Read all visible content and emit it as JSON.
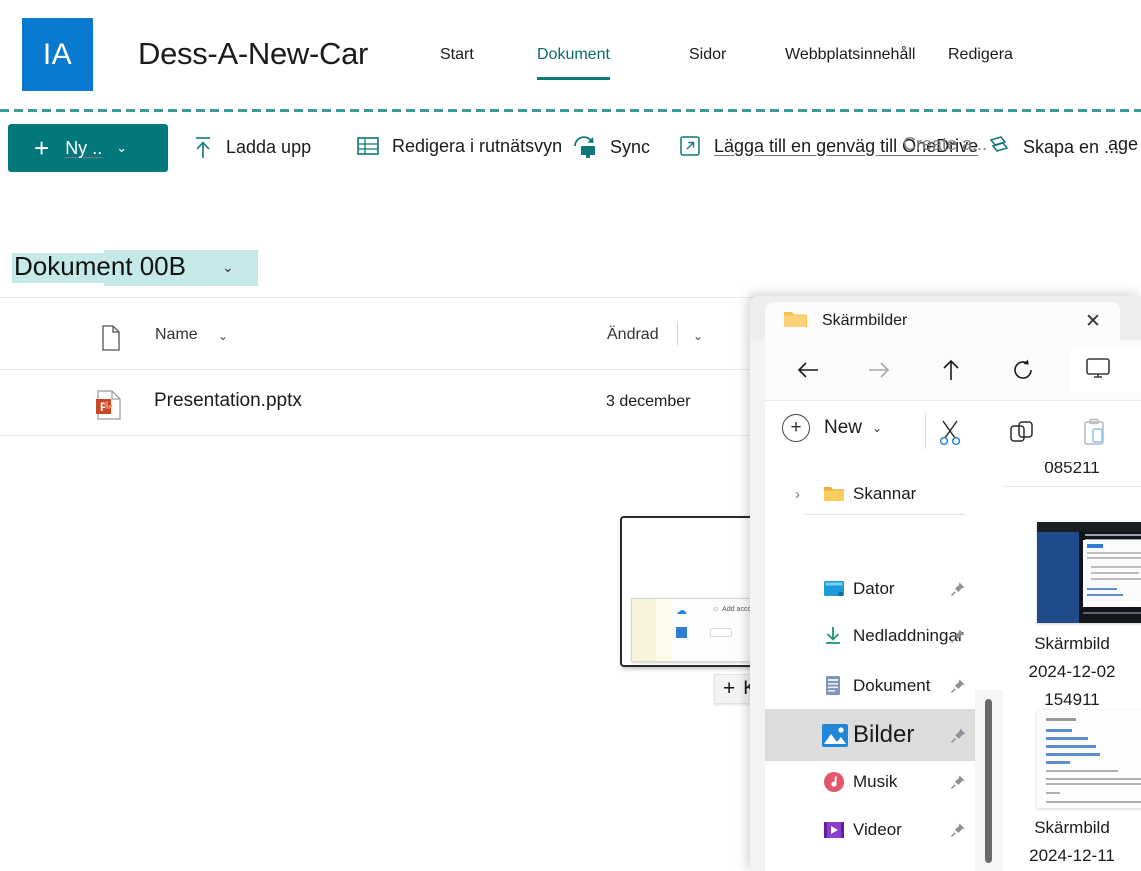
{
  "sharepoint": {
    "logo_text": "IA",
    "logo_color": "#0a7ad0",
    "site_title": "Dess-A-New-Car",
    "accent_color": "#03787c",
    "nav": [
      {
        "label": "Start",
        "active": false
      },
      {
        "label": "Dokument",
        "active": true
      },
      {
        "label": "Sidor",
        "active": false
      },
      {
        "label": "Webbplatsinnehåll",
        "active": false
      },
      {
        "label": "Redigera",
        "active": false
      }
    ],
    "commandbar": {
      "new_label": "Ny ..",
      "new_plus": "+",
      "new_chevron": "⌄",
      "items": [
        {
          "icon": "upload-icon",
          "label": "Ladda upp"
        },
        {
          "icon": "grid-icon",
          "label": "Redigera i rutnätsvyn"
        },
        {
          "icon": "sync-icon",
          "label": "Sync"
        },
        {
          "icon": "shortcut-icon",
          "label": "Lägga till en genväg till OneDrive"
        },
        {
          "icon": "flow-icon",
          "label": "Skapa en ..."
        },
        {
          "icon": "overlap-icon",
          "label": "Create a..."
        },
        {
          "icon": "cut-text",
          "label": "age"
        }
      ]
    },
    "library": {
      "title": "Dokument 00B",
      "title_chevron": "⌄",
      "highlight_color": "#c5e9e8"
    },
    "columns": {
      "name": "Name",
      "modified": "Ändrad",
      "chevron": "⌄"
    },
    "files": [
      {
        "icon": "powerpoint-icon",
        "name": "Presentation.pptx",
        "modified": "3 december"
      }
    ]
  },
  "drag": {
    "tooltip_plus": "+",
    "tooltip_label": "Knappen Kopiera.",
    "preview_caption": "Add account"
  },
  "explorer": {
    "tab_title": "Skärmbilder",
    "tab_folder_icon": "folder-icon",
    "close_label": "✕",
    "nav": {
      "back": "←",
      "forward": "→",
      "up": "↑",
      "refresh": "⟳",
      "address_icon": "monitor-icon",
      "address_chevron": "›"
    },
    "toolbar": {
      "new_label": "New",
      "new_chevron": "⌄",
      "icons": [
        "cut-icon",
        "copy-icon",
        "paste-icon",
        "rename-icon"
      ]
    },
    "tree": [
      {
        "label": "Skannar",
        "icon": "folder-icon",
        "expander": "›",
        "pinned": false,
        "selected": false
      },
      {
        "label": "Dator",
        "icon": "computer-icon",
        "expander": "",
        "pinned": true,
        "selected": false
      },
      {
        "label": "Nedladdningar",
        "icon": "download-icon",
        "expander": "",
        "pinned": true,
        "selected": false
      },
      {
        "label": "Dokument",
        "icon": "document-icon",
        "expander": "",
        "pinned": true,
        "selected": false
      },
      {
        "label": "Bilder",
        "icon": "pictures-icon",
        "expander": "",
        "pinned": true,
        "selected": true
      },
      {
        "label": "Musik",
        "icon": "music-icon",
        "expander": "",
        "pinned": true,
        "selected": false
      },
      {
        "label": "Videor",
        "icon": "video-icon",
        "expander": "",
        "pinned": true,
        "selected": false
      }
    ],
    "files": [
      {
        "caption_lines": [
          "085211"
        ],
        "thumb": "clipped-above"
      },
      {
        "caption_lines": [
          "Skärmbild",
          "2024-12-02",
          "154911"
        ],
        "thumb": "vpn-dark-screenshot"
      },
      {
        "caption_lines": [
          "Skärmbild",
          "2024-12-11"
        ],
        "thumb": "light-document-screenshot"
      }
    ]
  }
}
